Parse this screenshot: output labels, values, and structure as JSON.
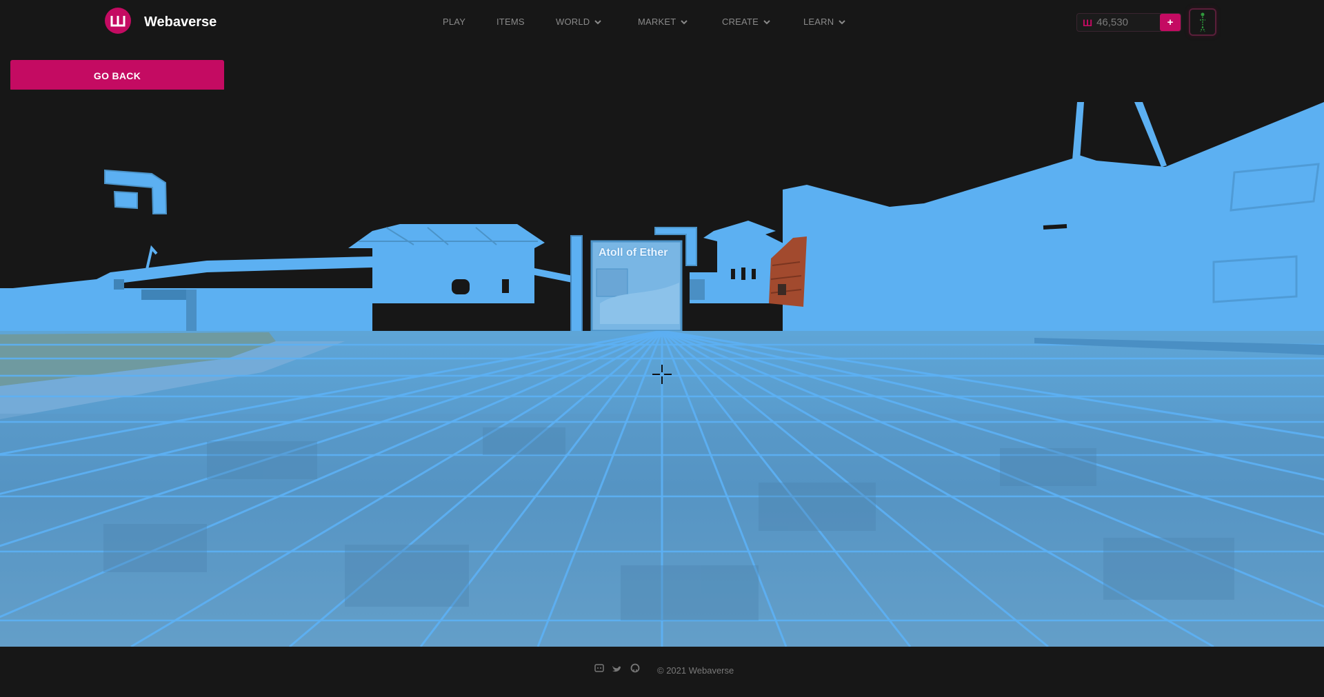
{
  "header": {
    "brand": "Webaverse",
    "logo_icon": "webaverse-logo-icon",
    "nav": [
      {
        "label": "PLAY",
        "has_dropdown": false
      },
      {
        "label": "ITEMS",
        "has_dropdown": false
      },
      {
        "label": "WORLD",
        "has_dropdown": true
      },
      {
        "label": "MARKET",
        "has_dropdown": true
      },
      {
        "label": "CREATE",
        "has_dropdown": true
      },
      {
        "label": "LEARN",
        "has_dropdown": true
      }
    ],
    "balance": {
      "symbol": "Ш",
      "value": "46,530",
      "add_label": "+"
    },
    "avatar_icon": "user-avatar-icon"
  },
  "actions": {
    "go_back_label": "GO BACK"
  },
  "scene": {
    "sign_title": "Atoll of Ether",
    "crosshair_icon": "crosshair-icon"
  },
  "footer": {
    "icons": [
      "discord-icon",
      "twitter-icon",
      "github-icon"
    ],
    "copyright": "© 2021 Webaverse"
  },
  "colors": {
    "accent": "#c40b62",
    "background": "#171717",
    "scene_blue": "#5cb0f2"
  }
}
